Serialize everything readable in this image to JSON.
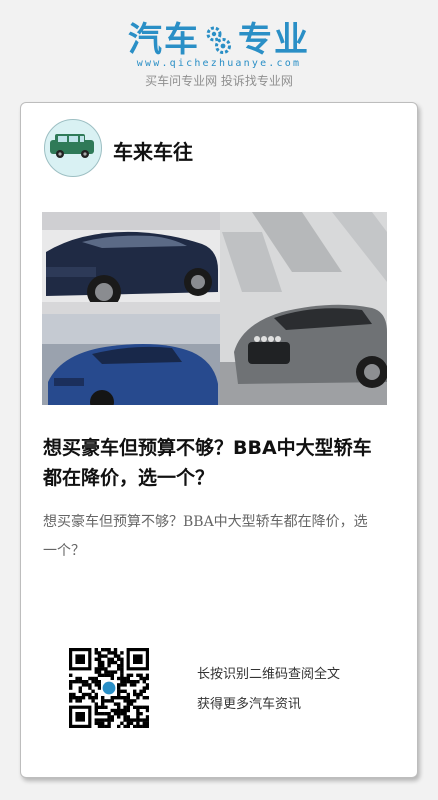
{
  "header": {
    "logo_left": "汽车",
    "logo_right": "专业",
    "logo_domain": "www.qichezhuanye.com",
    "slogan": "买车问专业网 投诉找专业网",
    "logo_icon": "gear-icon"
  },
  "card": {
    "author_name": "车来车往",
    "avatar_icon": "car-icon",
    "article_title": "想买豪车但预算不够？BBA中大型轿车都在降价，选一个？",
    "article_summary": "想买豪车但预算不够？BBA中大型轿车都在降价，选一个？",
    "qr_hint_line1": "长按识别二维码查阅全文",
    "qr_hint_line2": "获得更多汽车资讯"
  },
  "colors": {
    "brand": "#2a8fc6",
    "page_bg": "#f2f2f2",
    "card_bg": "#ffffff",
    "avatar_car": "#2f7a58"
  }
}
